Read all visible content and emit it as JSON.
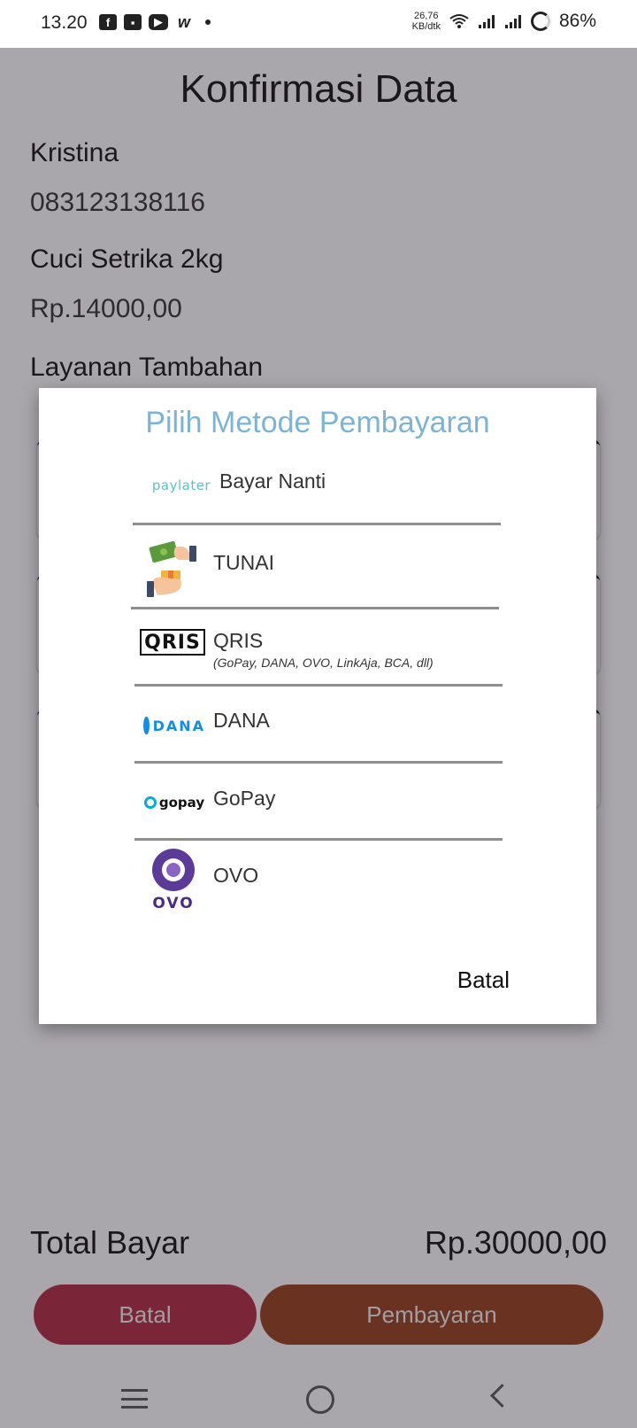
{
  "status_bar": {
    "time": "13.20",
    "speed_line1": "26,76",
    "speed_line2": "KB/dtk",
    "battery": "86%",
    "icons": [
      "facebook-icon",
      "store-icon",
      "youtube-icon",
      "w-icon",
      "dot-icon",
      "wifi-icon",
      "signal-icon",
      "signal-icon",
      "battery-ring-icon"
    ]
  },
  "page": {
    "title": "Konfirmasi Data",
    "customer_name": "Kristina",
    "phone": "083123138116",
    "service": "Cuci Setrika 2kg",
    "service_price": "Rp.14000,00",
    "extra_services_label": "Layanan Tambahan"
  },
  "dialog": {
    "title": "Pilih Metode Pembayaran",
    "options": [
      {
        "label": "Bayar Nanti",
        "logo_text": "paylater"
      },
      {
        "label": "TUNAI"
      },
      {
        "label": "QRIS",
        "sublabel": "(GoPay, DANA, OVO, LinkAja, BCA, dll)",
        "logo_text": "QRIS"
      },
      {
        "label": "DANA",
        "logo_text": "DANA"
      },
      {
        "label": "GoPay",
        "logo_text": "gopay"
      },
      {
        "label": "OVO",
        "logo_text": "OVO"
      }
    ],
    "cancel_label": "Batal"
  },
  "footer": {
    "total_label": "Total Bayar",
    "total_value": "Rp.30000,00",
    "cancel_button": "Batal",
    "pay_button": "Pembayaran"
  },
  "colors": {
    "dialog_title": "#7bb4d8",
    "batal_button": "#b12a3e",
    "pay_button": "#973f16",
    "dana": "#118ee9",
    "ovo": "#5c3a98",
    "card_top_border": "#121a4d"
  }
}
